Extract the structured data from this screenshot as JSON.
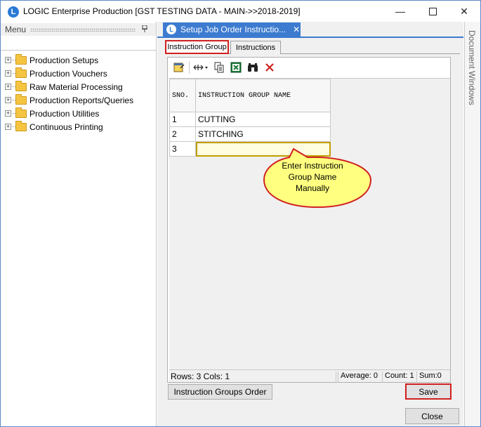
{
  "window": {
    "title": "LOGIC Enterprise Production  [GST TESTING DATA - MAIN->>2018-2019]",
    "logo": "L",
    "min_glyph": "—",
    "close_glyph": "✕"
  },
  "menu": {
    "title": "Menu",
    "pin_glyph": "📌",
    "items": [
      {
        "label": "Production Setups"
      },
      {
        "label": "Production Vouchers"
      },
      {
        "label": "Raw Material Processing"
      },
      {
        "label": "Production Reports/Queries"
      },
      {
        "label": "Production Utilities"
      },
      {
        "label": "Continuous Printing"
      }
    ],
    "expander_glyph": "+"
  },
  "document": {
    "tab_label": "Setup Job Order Instructio...",
    "tab_icon": "L",
    "tab_close": "✕",
    "inner_tabs": [
      "Instruction Group",
      "Instructions"
    ],
    "toolbar_icons": [
      "notepad-icon",
      "column-resize-icon",
      "copy-icon",
      "excel-icon",
      "binoculars-icon",
      "delete-icon"
    ],
    "grid": {
      "columns": [
        "SNO.",
        "INSTRUCTION GROUP NAME"
      ],
      "rows": [
        {
          "sno": "1",
          "name": "CUTTING"
        },
        {
          "sno": "2",
          "name": "STITCHING"
        },
        {
          "sno": "3",
          "name": ""
        }
      ]
    },
    "status": {
      "rows_cols": "Rows: 3  Cols: 1",
      "average": "Average: 0",
      "count": "Count: 1",
      "sum": "Sum:0"
    },
    "order_button": "Instruction Groups Order",
    "save_button": "Save",
    "close_button": "Close"
  },
  "doc_windows_label": "Document Windows",
  "callout": {
    "line1": "Enter Instruction",
    "line2": "Group Name",
    "line3": "Manually",
    "fill": "#ffff80",
    "stroke": "#d02020"
  }
}
